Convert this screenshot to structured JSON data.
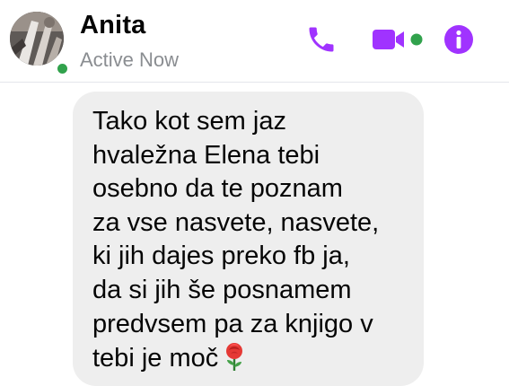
{
  "header": {
    "contact_name": "Anita",
    "status": "Active Now",
    "icons": {
      "phone": "phone-icon",
      "video": "video-camera-icon",
      "info": "info-icon"
    },
    "presence_color": "#31a24c",
    "accent_color": "#a033ff"
  },
  "message": {
    "lines": [
      "Tako kot sem jaz",
      "hvaležna Elena tebi",
      "osebno da te poznam",
      "za vse nasvete, nasvete,",
      "ki jih dajes preko fb ja,",
      "da si jih še posnamem",
      "predvsem pa za knjigo v",
      "tebi je moč"
    ],
    "emoji": "rose-emoji",
    "bubble_color": "#eeeeee"
  }
}
